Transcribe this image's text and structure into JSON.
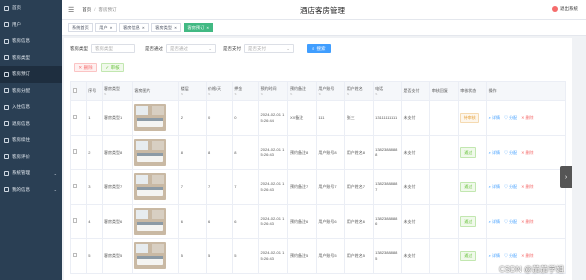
{
  "app_title": "酒店客房管理",
  "user": {
    "label": "退出系统"
  },
  "breadcrumb": {
    "home": "首页",
    "current": "客房预订"
  },
  "sidebar": [
    {
      "label": "首页",
      "icon": "home-icon"
    },
    {
      "label": "用户",
      "icon": "user-icon"
    },
    {
      "label": "客房信息",
      "icon": "room-icon"
    },
    {
      "label": "客房类型",
      "icon": "tag-icon"
    },
    {
      "label": "客房预订",
      "icon": "calendar-icon"
    },
    {
      "label": "客房分配",
      "icon": "assign-icon"
    },
    {
      "label": "入住信息",
      "icon": "checkin-icon"
    },
    {
      "label": "退房信息",
      "icon": "checkout-icon"
    },
    {
      "label": "客房续住",
      "icon": "renew-icon"
    },
    {
      "label": "客房评价",
      "icon": "comment-icon"
    },
    {
      "label": "系统管理",
      "icon": "settings-icon"
    },
    {
      "label": "我的信息",
      "icon": "profile-icon"
    }
  ],
  "tabs": [
    {
      "label": "系统首页"
    },
    {
      "label": "用户"
    },
    {
      "label": "客房信息"
    },
    {
      "label": "客房类型"
    },
    {
      "label": "客房预订"
    }
  ],
  "filters": {
    "room_type_label": "客房类型",
    "room_type_placeholder": "客房类型",
    "audit_label": "是否通过",
    "audit_placeholder": "是否通过",
    "pay_label": "是否支付",
    "pay_placeholder": "是否支付",
    "search_label": "搜索"
  },
  "actions": {
    "delete_label": "删除",
    "audit_label": "审核"
  },
  "table": {
    "columns": [
      "序号",
      "客房类型",
      "客房图片",
      "楼层",
      "价格/天",
      "押金",
      "预约时间",
      "预约备注",
      "用户账号",
      "用户姓名",
      "电话",
      "是否支付",
      "审核回复",
      "审核状态",
      "操作"
    ],
    "sort_mark": "⇅",
    "op_detail": "详情",
    "op_assign": "分配",
    "op_delete": "删除",
    "rows": [
      {
        "index": "1",
        "type": "客房类型1",
        "floor": "2",
        "price": "0",
        "deposit": "0",
        "time": "2024-02-01 15:26:44",
        "note": "XX备注",
        "account": "111",
        "name": "张三",
        "phone": "13111111111",
        "paid": "未支付",
        "reply": "",
        "status": "待审核",
        "status_kind": "pending"
      },
      {
        "index": "2",
        "type": "客房类型8",
        "floor": "8",
        "price": "8",
        "deposit": "8",
        "time": "2024-02-01 15:26:43",
        "note": "预约备注8",
        "account": "用户账号8",
        "name": "用户姓名8",
        "phone": "13823888888",
        "paid": "未支付",
        "reply": "",
        "status": "通过",
        "status_kind": "ok"
      },
      {
        "index": "3",
        "type": "客房类型7",
        "floor": "7",
        "price": "7",
        "deposit": "7",
        "time": "2024-02-01 15:26:43",
        "note": "预约备注7",
        "account": "用户账号7",
        "name": "用户姓名7",
        "phone": "13823888887",
        "paid": "未支付",
        "reply": "",
        "status": "通过",
        "status_kind": "ok"
      },
      {
        "index": "4",
        "type": "客房类型6",
        "floor": "6",
        "price": "6",
        "deposit": "6",
        "time": "2024-02-01 15:26:43",
        "note": "预约备注6",
        "account": "用户账号6",
        "name": "用户姓名6",
        "phone": "13823888886",
        "paid": "未支付",
        "reply": "",
        "status": "通过",
        "status_kind": "ok"
      },
      {
        "index": "5",
        "type": "客房类型5",
        "floor": "5",
        "price": "5",
        "deposit": "5",
        "time": "2024-02-01 15:26:43",
        "note": "预约备注5",
        "account": "用户账号5",
        "name": "用户姓名5",
        "phone": "13823888885",
        "paid": "未支付",
        "reply": "",
        "status": "通过",
        "status_kind": "ok"
      }
    ]
  },
  "watermark": "CSDN @茄茄学姐",
  "colors": {
    "sidebar": "#2a3f54",
    "accent": "#42b983",
    "primary": "#409eff",
    "danger": "#f56c6c"
  }
}
